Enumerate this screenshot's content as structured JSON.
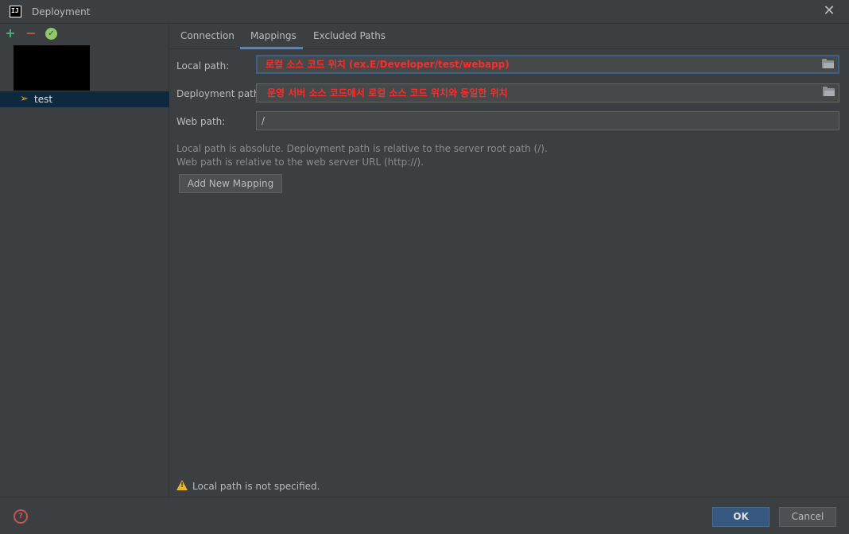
{
  "window": {
    "app_logo": "IJ",
    "title": "Deployment",
    "close_glyph": "✕"
  },
  "toolbar": {
    "add_glyph": "+",
    "remove_glyph": "−",
    "check_glyph": "✓"
  },
  "servers": [
    {
      "name": "test",
      "icon": "deploy-server-icon"
    }
  ],
  "tabs": [
    {
      "label": "Connection",
      "selected": false
    },
    {
      "label": "Mappings",
      "selected": true
    },
    {
      "label": "Excluded Paths",
      "selected": false
    }
  ],
  "mappings": {
    "local_path": {
      "label": "Local path:",
      "value": "로컬 소스 코드 위치 (ex.E/Developer/test/webapp)"
    },
    "deployment_path": {
      "label": "Deployment path:",
      "value": "운영 서버 소스 코드에서 로컬 소스 코드 위치와 동일한 위치"
    },
    "web_path": {
      "label": "Web path:",
      "value": "/"
    },
    "hint_line1": "Local path is absolute. Deployment path is relative to the server root path (/).",
    "hint_line2": "Web path is relative to the web server URL (http://).",
    "add_mapping_label": "Add New Mapping"
  },
  "warning": {
    "icon": "warning-icon",
    "text": "Local path is not specified."
  },
  "footer": {
    "help_glyph": "?",
    "ok_label": "OK",
    "cancel_label": "Cancel"
  },
  "colors": {
    "background": "#3c3f41",
    "selection": "#0d293e",
    "accent": "#4a88c7",
    "annotation_red": "#ff2b2b",
    "warning": "#e8b52c"
  }
}
